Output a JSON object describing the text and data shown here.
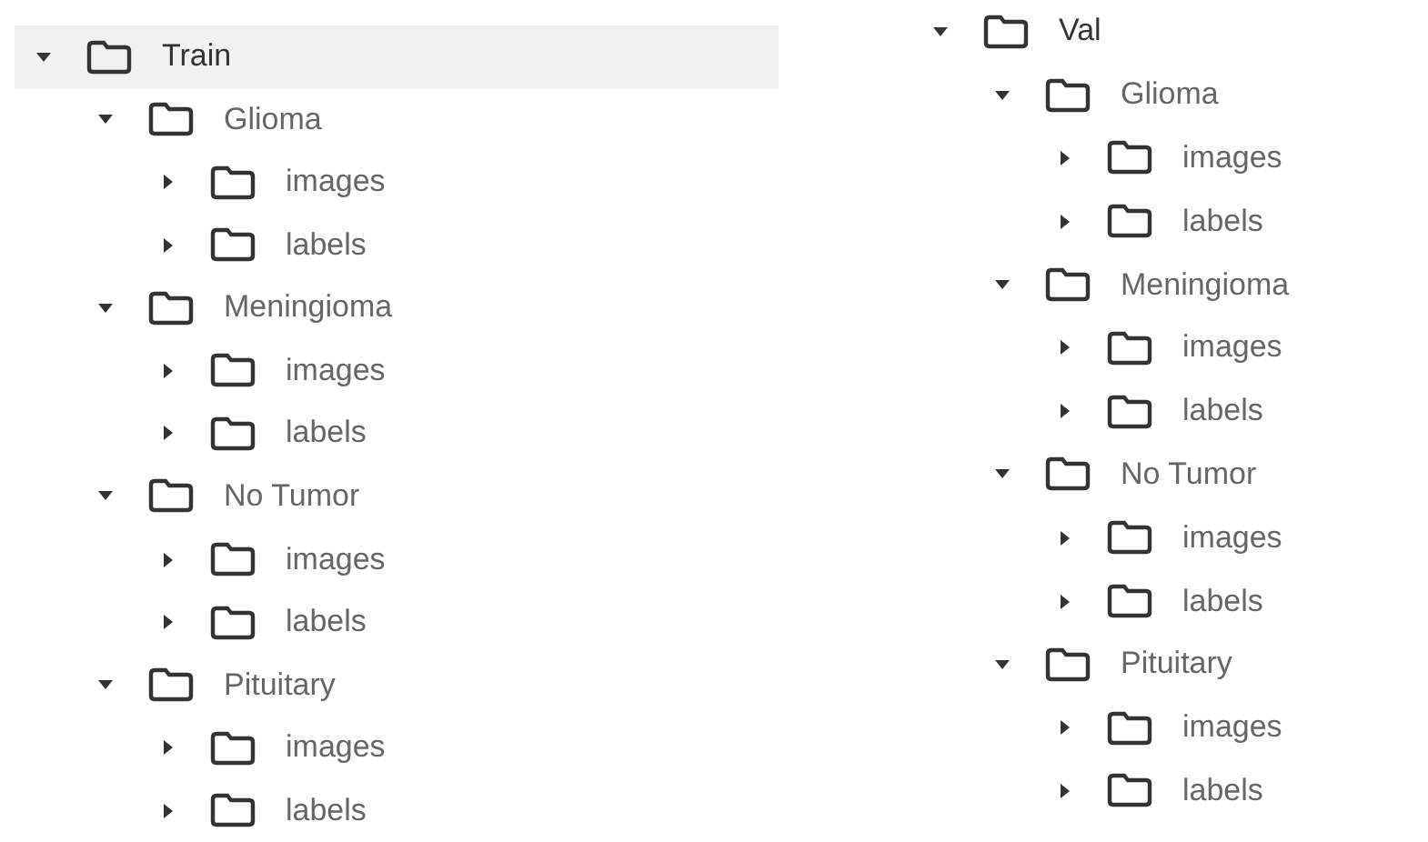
{
  "trees": [
    {
      "label": "Train",
      "expanded": true,
      "selected": true,
      "children": [
        {
          "label": "Glioma",
          "expanded": true,
          "selected": false,
          "children": [
            {
              "label": "images",
              "expanded": false,
              "selected": false
            },
            {
              "label": "labels",
              "expanded": false,
              "selected": false
            }
          ]
        },
        {
          "label": "Meningioma",
          "expanded": true,
          "selected": false,
          "children": [
            {
              "label": "images",
              "expanded": false,
              "selected": false
            },
            {
              "label": "labels",
              "expanded": false,
              "selected": false
            }
          ]
        },
        {
          "label": "No Tumor",
          "expanded": true,
          "selected": false,
          "children": [
            {
              "label": "images",
              "expanded": false,
              "selected": false
            },
            {
              "label": "labels",
              "expanded": false,
              "selected": false
            }
          ]
        },
        {
          "label": "Pituitary",
          "expanded": true,
          "selected": false,
          "children": [
            {
              "label": "images",
              "expanded": false,
              "selected": false
            },
            {
              "label": "labels",
              "expanded": false,
              "selected": false
            }
          ]
        }
      ]
    },
    {
      "label": "Val",
      "expanded": true,
      "selected": false,
      "children": [
        {
          "label": "Glioma",
          "expanded": true,
          "selected": false,
          "children": [
            {
              "label": "images",
              "expanded": false,
              "selected": false
            },
            {
              "label": "labels",
              "expanded": false,
              "selected": false
            }
          ]
        },
        {
          "label": "Meningioma",
          "expanded": true,
          "selected": false,
          "children": [
            {
              "label": "images",
              "expanded": false,
              "selected": false
            },
            {
              "label": "labels",
              "expanded": false,
              "selected": false
            }
          ]
        },
        {
          "label": "No Tumor",
          "expanded": true,
          "selected": false,
          "children": [
            {
              "label": "images",
              "expanded": false,
              "selected": false
            },
            {
              "label": "labels",
              "expanded": false,
              "selected": false
            }
          ]
        },
        {
          "label": "Pituitary",
          "expanded": true,
          "selected": false,
          "children": [
            {
              "label": "images",
              "expanded": false,
              "selected": false
            },
            {
              "label": "labels",
              "expanded": false,
              "selected": false
            }
          ]
        }
      ]
    }
  ]
}
